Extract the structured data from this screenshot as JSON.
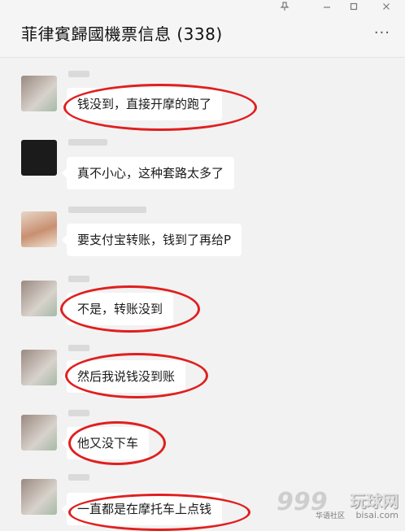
{
  "window": {
    "title": "菲律賓歸國機票信息 (338)",
    "pin_icon": "pin-icon",
    "minimize_icon": "minimize-icon",
    "maximize_icon": "maximize-icon",
    "close_icon": "close-icon",
    "more_icon": "more-icon"
  },
  "messages": [
    {
      "text": "钱没到，直接开摩的跑了",
      "highlighted": true
    },
    {
      "text": "真不小心，这种套路太多了",
      "highlighted": false
    },
    {
      "text": "要支付宝转账，钱到了再给P",
      "highlighted": false
    },
    {
      "text": "不是，转账没到",
      "highlighted": true
    },
    {
      "text": "然后我说钱没到账",
      "highlighted": true
    },
    {
      "text": "他又没下车",
      "highlighted": true
    },
    {
      "text": "一直都是在摩托车上点钱",
      "highlighted": true
    }
  ],
  "watermark": {
    "logo_text": "999",
    "brand": "玩球网",
    "small": "华语社区",
    "domain": "bisai.com"
  },
  "colors": {
    "highlight_circle": "#e01f1f",
    "bubble": "#ffffff",
    "background": "#f2f2f2"
  }
}
